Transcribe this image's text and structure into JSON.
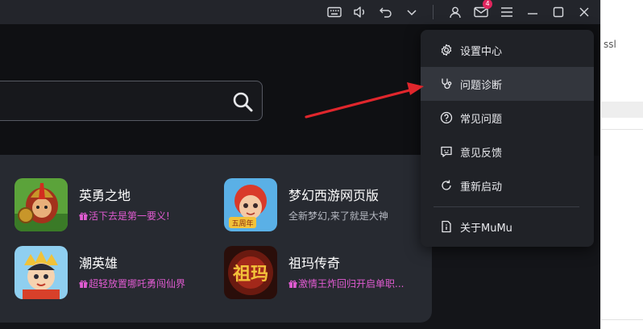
{
  "titlebar": {
    "icons": [
      "keyboard-icon",
      "volume-icon",
      "undo-icon",
      "chevron-down-icon",
      "user-icon",
      "mail-icon",
      "menu-icon",
      "minimize-icon",
      "maximize-icon",
      "close-icon"
    ],
    "mail_badge": "4"
  },
  "search": {
    "icon": "search-icon"
  },
  "games": [
    {
      "name": "英勇之地",
      "desc": "活下去是第一要义!",
      "gift": true
    },
    {
      "name": "梦幻西游网页版",
      "desc": "全新梦幻,来了就是大神",
      "gift": false,
      "cover_text": "五周年"
    },
    {
      "name": "潮英雄",
      "desc": "超轻放置哪吒勇闯仙界",
      "gift": true
    },
    {
      "name": "祖玛传奇",
      "desc": "激情王炸回归开启单职...",
      "gift": true,
      "cover_text": "祖玛"
    }
  ],
  "menu": {
    "items": [
      {
        "label": "设置中心",
        "icon": "gear-icon"
      },
      {
        "label": "问题诊断",
        "icon": "stethoscope-icon"
      },
      {
        "label": "常见问题",
        "icon": "question-icon"
      },
      {
        "label": "意见反馈",
        "icon": "feedback-icon"
      },
      {
        "label": "重新启动",
        "icon": "restart-icon"
      },
      {
        "label": "关于MuMu",
        "icon": "info-icon"
      }
    ],
    "active_index": 1
  },
  "right_panel": {
    "text": "ssl"
  },
  "colors": {
    "accent_pink": "#e05bd1",
    "annotation_arrow": "#e0262c",
    "badge": "#e0255d"
  }
}
